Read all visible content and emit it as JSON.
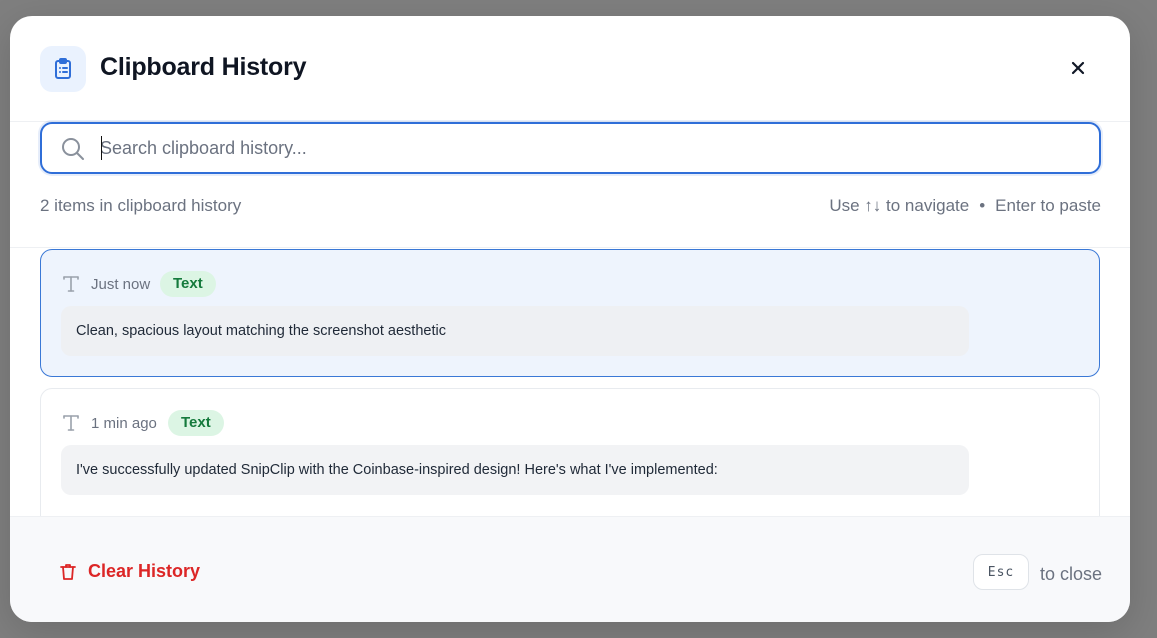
{
  "modal": {
    "title": "Clipboard History"
  },
  "search": {
    "placeholder": "Search clipboard history...",
    "value": ""
  },
  "meta": {
    "count_text": "2 items in clipboard history",
    "nav_hint": "Use ↑↓ to navigate",
    "separator": "•",
    "paste_hint": "Enter to paste"
  },
  "items": [
    {
      "time": "Just now",
      "type": "Text",
      "content": "Clean, spacious layout matching the screenshot aesthetic",
      "selected": true
    },
    {
      "time": "1 min ago",
      "type": "Text",
      "content": "I've successfully updated SnipClip with the Coinbase-inspired design! Here's what I've implemented:",
      "selected": false
    }
  ],
  "footer": {
    "clear_label": "Clear History",
    "esc_key": "Esc",
    "esc_hint": "to close"
  },
  "colors": {
    "accent": "#2f6ed8",
    "danger": "#dc2626",
    "badge_bg": "#dcf5e4",
    "badge_text": "#157a3c"
  }
}
